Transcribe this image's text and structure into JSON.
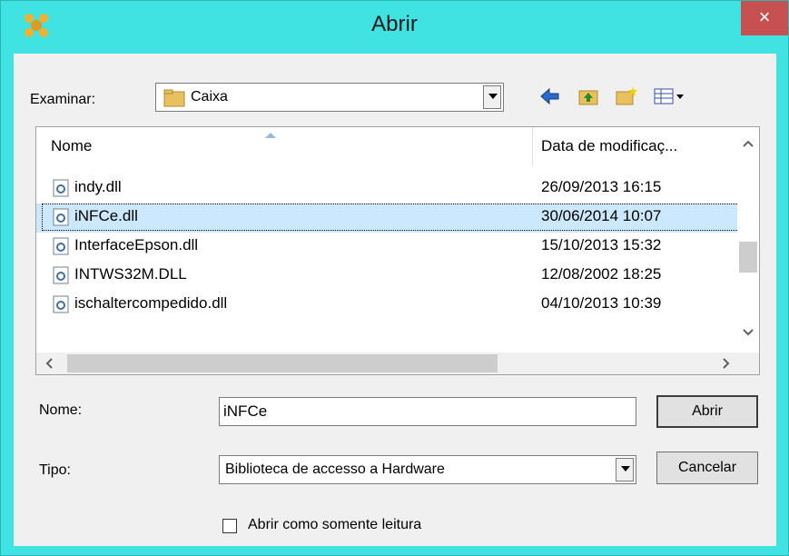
{
  "window": {
    "title": "Abrir",
    "close_label": "×"
  },
  "look_in": {
    "label": "Examinar:",
    "value": "Caixa"
  },
  "list": {
    "columns": [
      "Nome",
      "Data de modificaç..."
    ],
    "rows": [
      {
        "name": "indy.dll",
        "date": "26/09/2013 16:15"
      },
      {
        "name": "iNFCe.dll",
        "date": "30/06/2014 10:07"
      },
      {
        "name": "InterfaceEpson.dll",
        "date": "15/10/2013 15:32"
      },
      {
        "name": "INTWS32M.DLL",
        "date": "12/08/2002 18:25"
      },
      {
        "name": "ischaltercompedido.dll",
        "date": "04/10/2013 10:39"
      }
    ],
    "selected_index": 1
  },
  "filename": {
    "label": "Nome:",
    "value": "iNFCe"
  },
  "filetype": {
    "label": "Tipo:",
    "value": "Biblioteca de accesso a Hardware"
  },
  "buttons": {
    "open": "Abrir",
    "cancel": "Cancelar"
  },
  "readonly": {
    "label": "Abrir como somente leitura",
    "checked": false
  },
  "colors": {
    "frame": "#41e2e2",
    "close": "#c75050",
    "selection": "#cce8ff"
  },
  "icons": [
    "app-icon",
    "folder-icon",
    "back-arrow-icon",
    "up-folder-icon",
    "new-folder-icon",
    "view-menu-icon",
    "dll-file-icon"
  ]
}
